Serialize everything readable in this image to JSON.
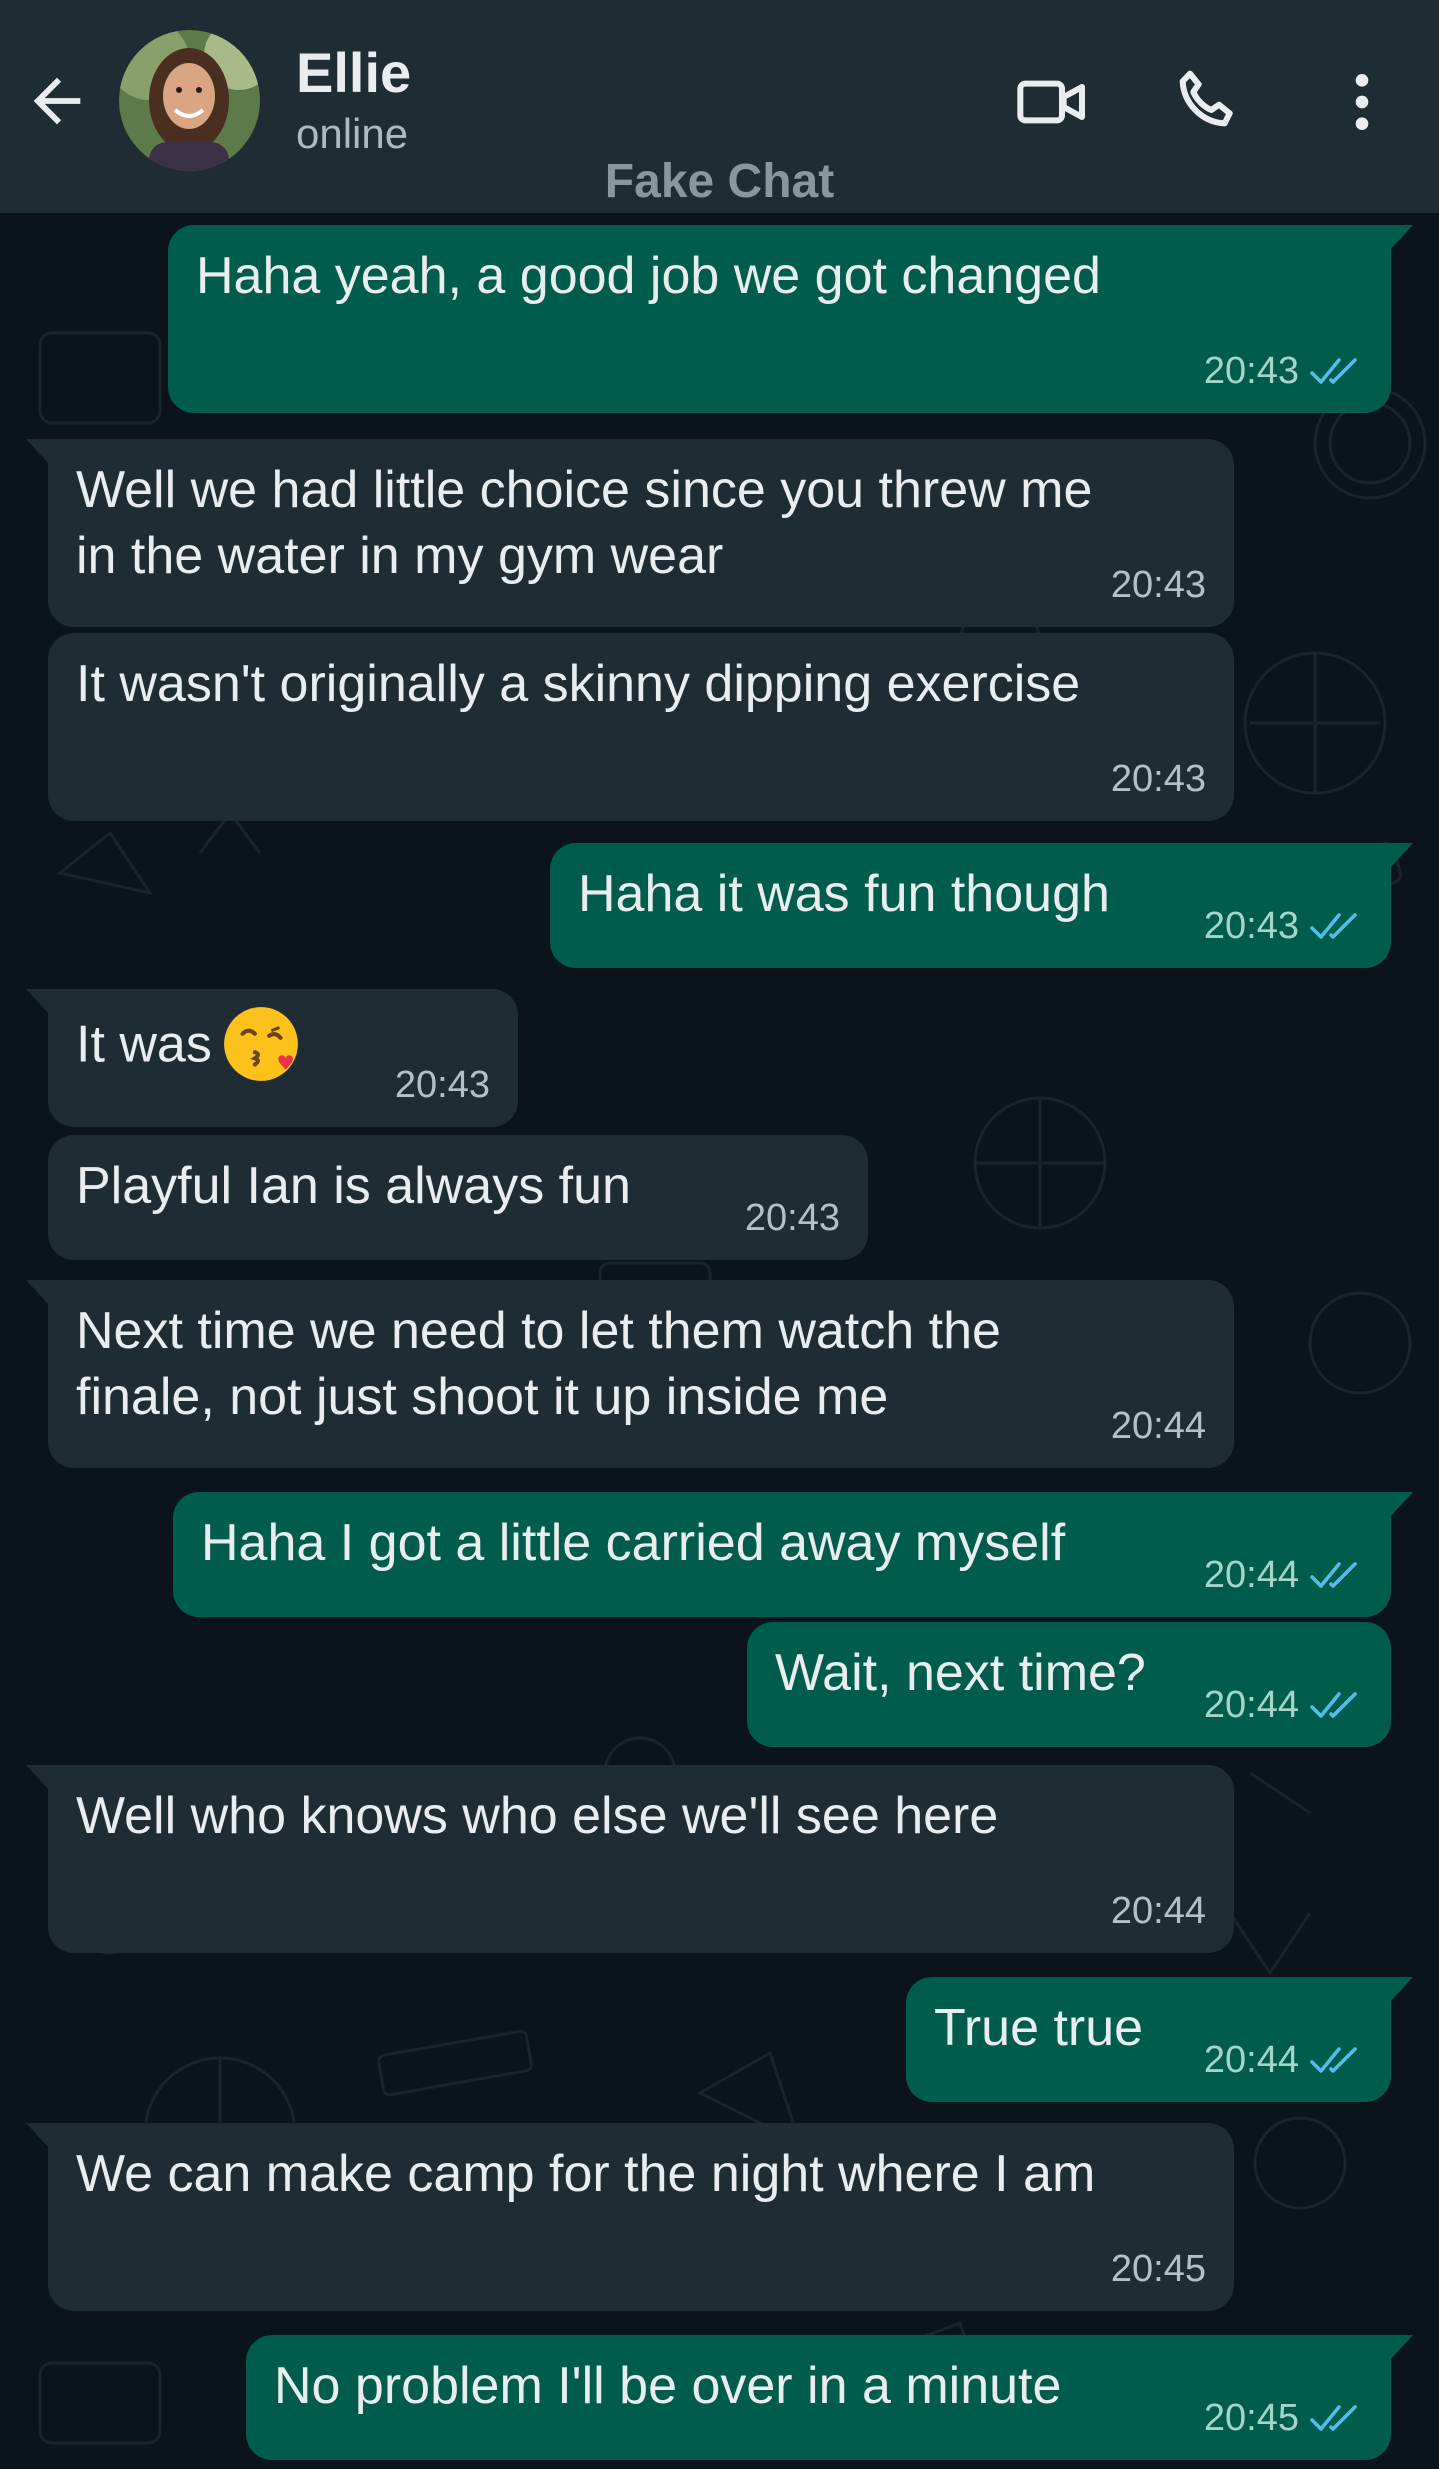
{
  "header": {
    "contact_name": "Ellie",
    "status": "online",
    "watermark": "Fake Chat",
    "icons": [
      "back-arrow-icon",
      "video-call-icon",
      "voice-call-icon",
      "more-options-icon"
    ]
  },
  "colors": {
    "header_bg": "#1f2c34",
    "chat_bg": "#0b141a",
    "incoming_bubble": "#202c33",
    "outgoing_bubble": "#005c4b",
    "read_ticks": "#53bdeb"
  },
  "messages": [
    {
      "dir": "out",
      "text": "Haha yeah, a good job we got changed",
      "time": "20:43",
      "read": true
    },
    {
      "dir": "in",
      "text": "Well we had little choice since you threw me\nin the water in my gym wear",
      "time": "20:43"
    },
    {
      "dir": "in",
      "text": "It wasn't originally a skinny dipping exercise",
      "time": "20:43"
    },
    {
      "dir": "out",
      "text": "Haha it was fun though",
      "time": "20:43",
      "read": true
    },
    {
      "dir": "in",
      "text": "It was",
      "emoji": "kissing-face-with-heart-emoji",
      "time": "20:43"
    },
    {
      "dir": "in",
      "text": "Playful Ian is always fun",
      "time": "20:43"
    },
    {
      "dir": "in",
      "text": "Next time we need to let them watch the\nfinale, not just shoot it up inside me",
      "time": "20:44"
    },
    {
      "dir": "out",
      "text": "Haha I got a little carried away myself",
      "time": "20:44",
      "read": true
    },
    {
      "dir": "out",
      "text": "Wait, next time?",
      "time": "20:44",
      "read": true
    },
    {
      "dir": "in",
      "text": "Well who knows who else we'll see here",
      "time": "20:44"
    },
    {
      "dir": "out",
      "text": "True true",
      "time": "20:44",
      "read": true
    },
    {
      "dir": "in",
      "text": "We can make camp for the night where I am",
      "time": "20:45"
    },
    {
      "dir": "out",
      "text": "No problem I'll be over in a minute",
      "time": "20:45",
      "read": true
    }
  ]
}
